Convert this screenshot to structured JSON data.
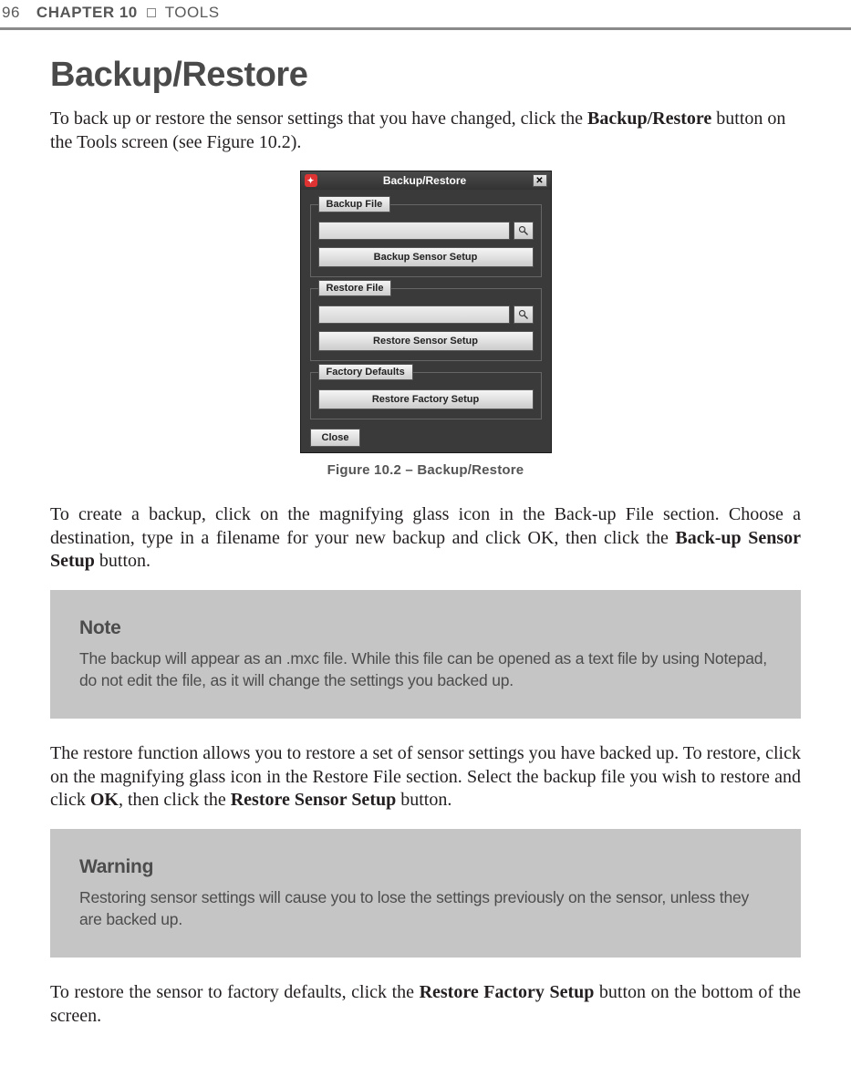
{
  "header": {
    "page_number": "96",
    "chapter": "CHAPTER 10",
    "section": "TOOLS"
  },
  "title": "Backup/Restore",
  "intro": {
    "pre": "To back up or restore the sensor settings that you have changed, click the ",
    "bold": "Backup/Restore",
    "post": " button on the Tools screen (see Figure 10.2)."
  },
  "dialog": {
    "title": "Backup/Restore",
    "groups": {
      "backup": {
        "label": "Backup File",
        "button": "Backup Sensor Setup"
      },
      "restore": {
        "label": "Restore File",
        "button": "Restore Sensor Setup"
      },
      "factory": {
        "label": "Factory Defaults",
        "button": "Restore Factory Setup"
      }
    },
    "close": "Close"
  },
  "figure_caption": "Figure 10.2 – Backup/Restore",
  "para2": {
    "pre": "To create a backup, click on the magnifying glass icon in the Back-up File section. Choose a destination, type in a filename for your new backup and click OK, then click the ",
    "bold": "Back-up Sensor Setup",
    "post": " button."
  },
  "note": {
    "title": "Note",
    "body": "The backup will appear as an .mxc file. While this file can be opened as a text file by using Notepad, do not edit the file, as it will change the settings you backed up."
  },
  "para3": {
    "pre": "The restore function allows you to restore a set of sensor settings you have backed up. To restore, click on the magnifying glass icon in the Restore File section. Select the backup file you wish to restore and click ",
    "bold1": "OK",
    "mid": ", then click the ",
    "bold2": "Restore Sensor Setup",
    "post": " button."
  },
  "warning": {
    "title": "Warning",
    "body": "Restoring sensor settings will cause you to lose the settings previously on the sensor, unless they are backed up."
  },
  "para4": {
    "pre": "To restore the sensor to factory defaults, click the ",
    "bold": "Restore Factory Setup",
    "post": " button on the bottom of the screen."
  }
}
